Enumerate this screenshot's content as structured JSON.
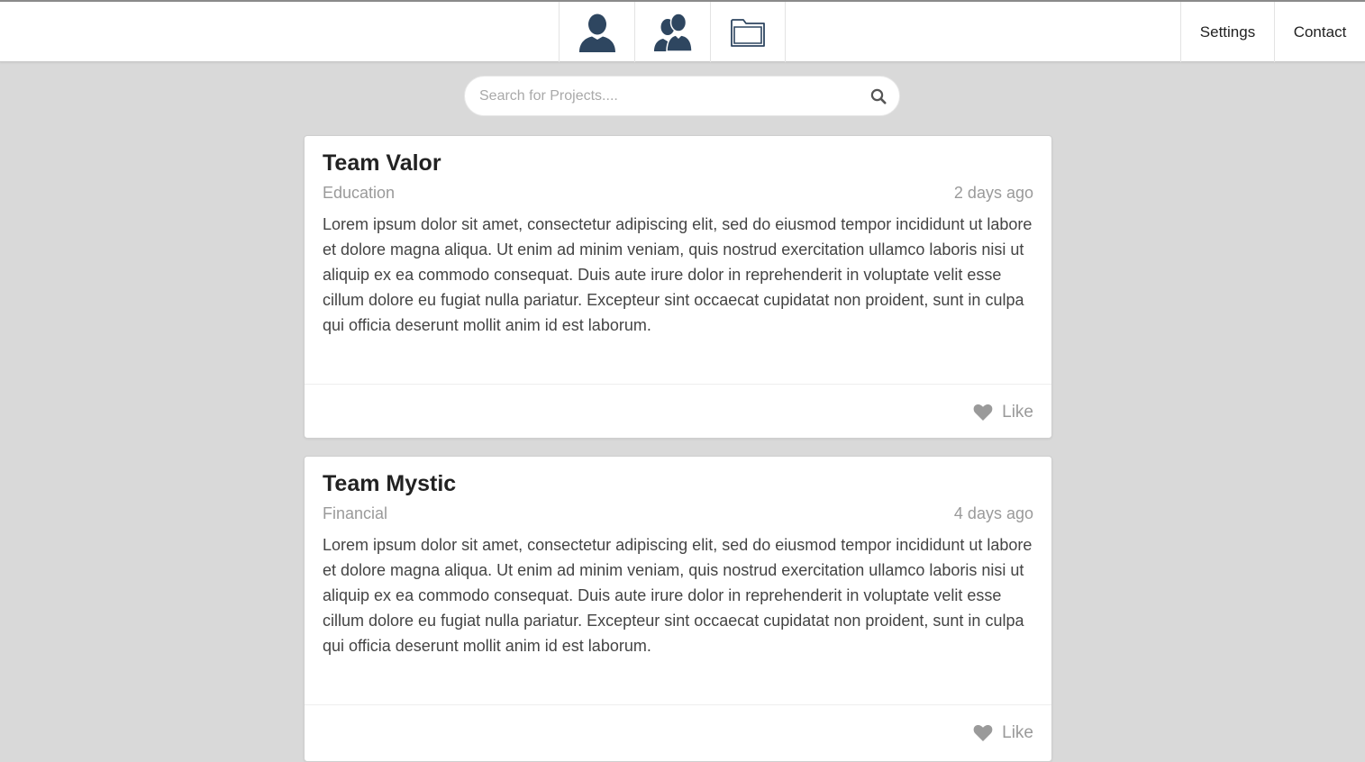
{
  "nav": {
    "icons": [
      {
        "name": "user-icon"
      },
      {
        "name": "users-icon"
      },
      {
        "name": "folder-icon"
      }
    ],
    "settings_label": "Settings",
    "contact_label": "Contact"
  },
  "search": {
    "placeholder": "Search for Projects....",
    "value": "",
    "icon": "search-icon"
  },
  "colors": {
    "background": "#d9d9d9",
    "icon_navy": "#2e4660",
    "muted": "#9a9a9a"
  },
  "posts": [
    {
      "title": "Team Valor",
      "category": "Education",
      "time": "2 days ago",
      "body": "Lorem ipsum dolor sit amet, consectetur adipiscing elit, sed do eiusmod tempor incididunt ut labore et dolore magna aliqua. Ut enim ad minim veniam, quis nostrud exercitation ullamco laboris nisi ut aliquip ex ea commodo consequat. Duis aute irure dolor in reprehenderit in voluptate velit esse cillum dolore eu fugiat nulla pariatur. Excepteur sint occaecat cupidatat non proident, sunt in culpa qui officia deserunt mollit anim id est laborum.",
      "like_label": "Like"
    },
    {
      "title": "Team Mystic",
      "category": "Financial",
      "time": "4 days ago",
      "body": "Lorem ipsum dolor sit amet, consectetur adipiscing elit, sed do eiusmod tempor incididunt ut labore et dolore magna aliqua. Ut enim ad minim veniam, quis nostrud exercitation ullamco laboris nisi ut aliquip ex ea commodo consequat. Duis aute irure dolor in reprehenderit in voluptate velit esse cillum dolore eu fugiat nulla pariatur. Excepteur sint occaecat cupidatat non proident, sunt in culpa qui officia deserunt mollit anim id est laborum.",
      "like_label": "Like"
    }
  ]
}
